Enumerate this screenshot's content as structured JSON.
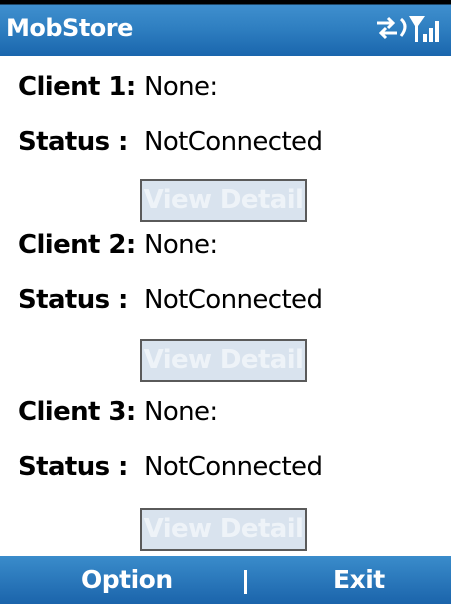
{
  "app": {
    "title": "MobStore"
  },
  "status_bar": {
    "icons": [
      "connection-arrows-icon",
      "signal-strength-icon"
    ]
  },
  "clients": [
    {
      "client_label": "Client 1:",
      "client_value": "None:",
      "status_label": "Status :",
      "status_value": "NotConnected",
      "button_label": "View Detail"
    },
    {
      "client_label": "Client 2:",
      "client_value": "None:",
      "status_label": "Status :",
      "status_value": "NotConnected",
      "button_label": "View Detail"
    },
    {
      "client_label": "Client 3:",
      "client_value": "None:",
      "status_label": "Status :",
      "status_value": "NotConnected",
      "button_label": "View Detail"
    }
  ],
  "softkeys": {
    "left": "Option",
    "right": "Exit"
  },
  "colors": {
    "title_bar": "#2f7fc1",
    "softkey_bar": "#1b64ab",
    "button_bg": "#d9e3ee",
    "button_text": "#eef3f8"
  }
}
